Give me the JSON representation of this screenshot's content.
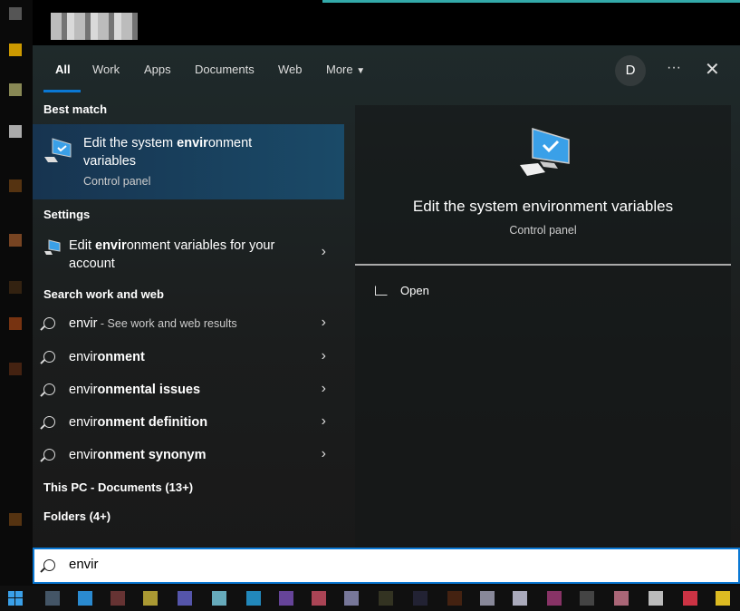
{
  "tabs": [
    {
      "label": "All",
      "active": true
    },
    {
      "label": "Work"
    },
    {
      "label": "Apps"
    },
    {
      "label": "Documents"
    },
    {
      "label": "Web"
    },
    {
      "label": "More"
    }
  ],
  "header": {
    "avatar": "D",
    "more_options": "···",
    "close": "✕"
  },
  "best_match": {
    "heading": "Best match",
    "title_pre": "Edit the system ",
    "title_bold": "envir",
    "title_post": "onment variables",
    "subtitle": "Control panel",
    "icon": "computer-check-icon"
  },
  "settings": {
    "heading": "Settings",
    "item": {
      "pre": "Edit ",
      "bold": "envir",
      "post": "onment variables for your account"
    }
  },
  "web": {
    "heading": "Search work and web",
    "items": [
      {
        "pre": "envir",
        "bold": "",
        "suffix": " - See work and web results"
      },
      {
        "pre": "envir",
        "bold": "onment"
      },
      {
        "pre": "envir",
        "bold": "onmental issues"
      },
      {
        "pre": "envir",
        "bold": "onment definition"
      },
      {
        "pre": "envir",
        "bold": "onment synonym"
      }
    ]
  },
  "documents_heading": "This PC - Documents (13+)",
  "folders_heading": "Folders (4+)",
  "preview": {
    "title": "Edit the system environment variables",
    "subtitle": "Control panel",
    "open_label": "Open"
  },
  "search": {
    "value": "envir"
  },
  "colors": {
    "accent": "#0a78d4",
    "selected": "#1a4a68"
  }
}
